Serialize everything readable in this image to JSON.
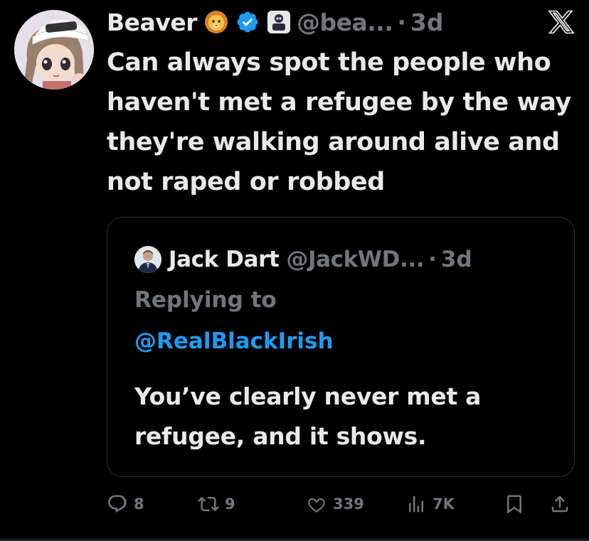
{
  "author": {
    "display_name": "Beaver",
    "name_emoji": "🦁",
    "handle": "@bea...",
    "dot": "·",
    "time": "3d"
  },
  "tweet_text": "Can always spot the people who haven't met a refugee by the way they're walking around alive and not raped or robbed",
  "quote": {
    "display_name": "Jack Dart",
    "handle": "@JackWD...",
    "dot": "·",
    "time": "3d",
    "replying_label": "Replying to",
    "replying_to": "@RealBlackIrish",
    "text": "You’ve clearly never met a refugee, and it shows."
  },
  "actions": {
    "replies": "8",
    "reposts": "9",
    "likes": "339",
    "views": "7K"
  },
  "colors": {
    "background": "#000000",
    "text": "#e7e9ea",
    "muted": "#71767b",
    "link": "#1d9bf0",
    "verified": "#1d9bf0"
  },
  "icons": [
    "x-logo-icon",
    "verified-icon",
    "reply-icon",
    "repost-icon",
    "like-icon",
    "views-icon",
    "bookmark-icon",
    "share-icon"
  ]
}
